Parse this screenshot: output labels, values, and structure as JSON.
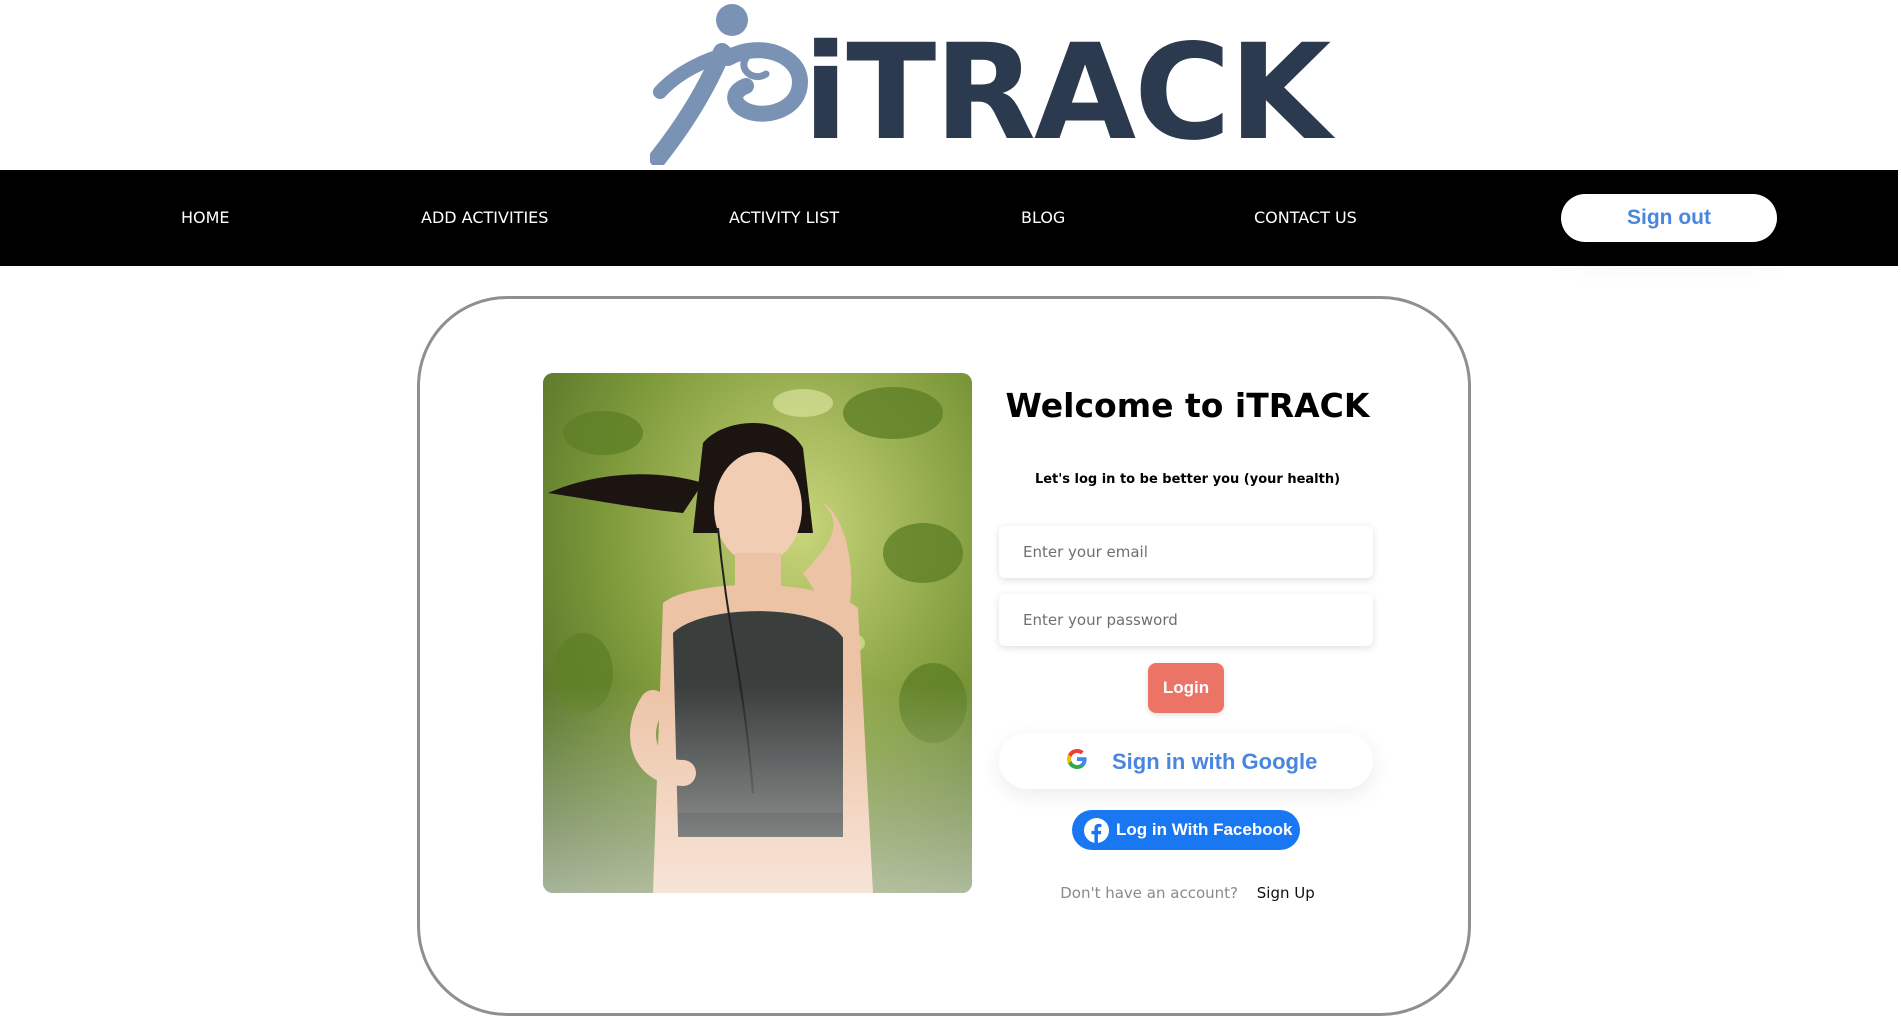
{
  "brand": {
    "logo_text": "iTRACK",
    "logo_icon": "runner-icon",
    "mark_color": "#7a93b4",
    "text_color": "#2b3a4e"
  },
  "nav": {
    "items": [
      {
        "label": "HOME"
      },
      {
        "label": "ADD ACTIVITIES"
      },
      {
        "label": "ACTIVITY LIST"
      },
      {
        "label": "BLOG"
      },
      {
        "label": "CONTACT US"
      }
    ],
    "signout_label": "Sign out",
    "background": "#000000"
  },
  "login": {
    "title": "Welcome to iTRACK",
    "subtitle": "Let's log in to be better you (your health)",
    "email_placeholder": "Enter your email",
    "password_placeholder": "Enter your password",
    "login_label": "Login",
    "google_label": "Sign in with Google",
    "google_icon": "google-icon",
    "facebook_label": "Log in With Facebook",
    "facebook_icon": "facebook-icon",
    "no_account_text": "Don't have an account?",
    "signup_label": "Sign Up",
    "accent_login": "#ec7467",
    "accent_facebook": "#1a77f2",
    "accent_google_text": "#4a86e0"
  }
}
